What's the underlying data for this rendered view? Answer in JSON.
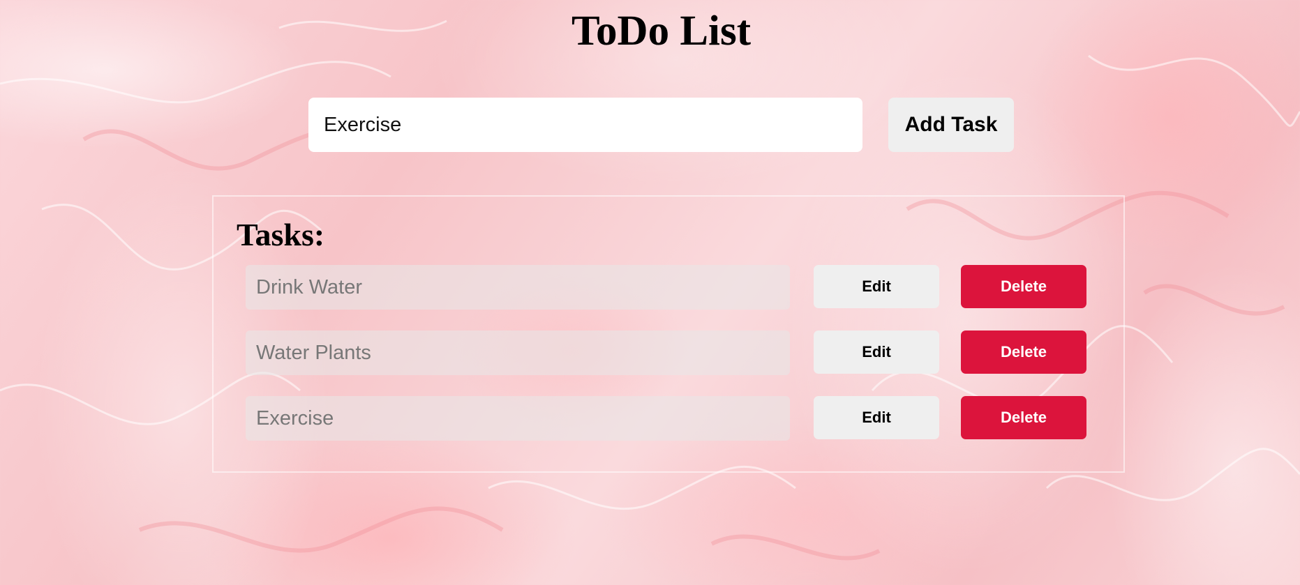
{
  "app": {
    "title": "ToDo List"
  },
  "new_task": {
    "value": "Exercise",
    "add_label": "Add Task"
  },
  "tasks": {
    "heading": "Tasks:",
    "items": [
      {
        "text": "Drink Water",
        "edit_label": "Edit",
        "delete_label": "Delete"
      },
      {
        "text": "Water Plants",
        "edit_label": "Edit",
        "delete_label": "Delete"
      },
      {
        "text": "Exercise",
        "edit_label": "Edit",
        "delete_label": "Delete"
      }
    ]
  },
  "colors": {
    "delete": "#dc143c",
    "button": "#efefef",
    "background": "#f8cfd2"
  }
}
